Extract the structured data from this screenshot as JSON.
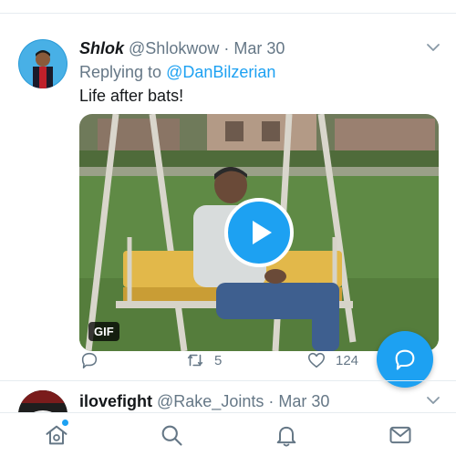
{
  "tweet": {
    "display_name": "Shlok",
    "handle": "@Shlokwow",
    "separator": "·",
    "date": "Mar 30",
    "replying_prefix": "Replying to",
    "replying_to": "@DanBilzerian",
    "text": "Life after bats!",
    "media_badge": "GIF",
    "retweets": "5",
    "likes": "124"
  },
  "next_tweet": {
    "display_name": "ilovefight",
    "handle": "@Rake_Joints",
    "separator": "·",
    "date": "Mar 30"
  },
  "icons": {
    "reply": "comment-icon",
    "retweet": "retweet-icon",
    "like": "heart-icon",
    "share": "share-icon",
    "compose": "compose-reply-icon",
    "menu": "chevron-down-icon",
    "nav": [
      "home-icon",
      "search-icon",
      "notifications-icon",
      "messages-icon"
    ]
  },
  "colors": {
    "accent": "#1da1f2",
    "secondary_text": "#657786",
    "primary_text": "#14171a",
    "divider": "#e6ecf0"
  }
}
